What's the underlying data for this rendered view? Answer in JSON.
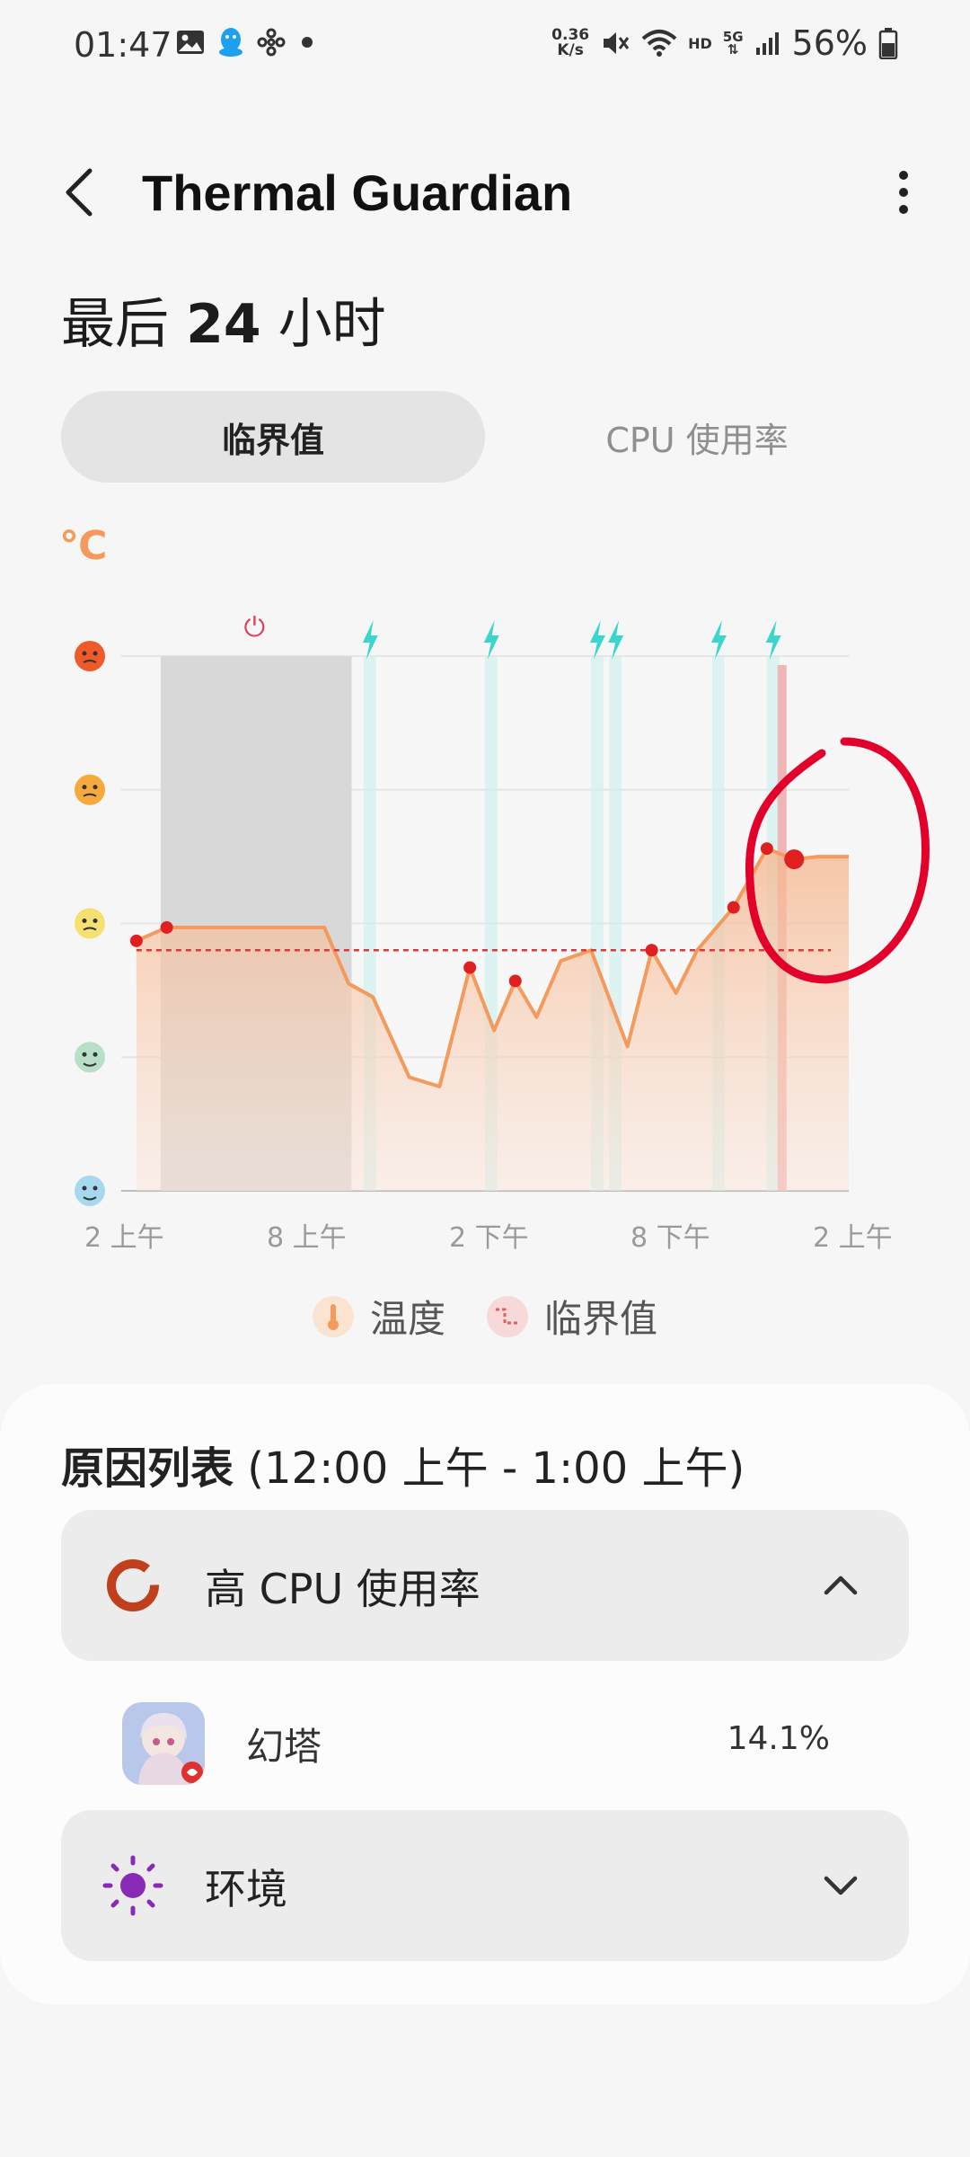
{
  "status_bar": {
    "time": "01:47",
    "net_speed_value": "0.36",
    "net_speed_unit": "K/s",
    "hd_label": "HD",
    "network_type": "5G",
    "battery": "56%"
  },
  "app_bar": {
    "title": "Thermal Guardian"
  },
  "range": {
    "prefix": "最后",
    "number": "24",
    "suffix": "小时"
  },
  "tabs": [
    {
      "label": "临界值",
      "selected": true
    },
    {
      "label": "CPU 使用率",
      "selected": false
    }
  ],
  "chart_data": {
    "type": "area",
    "y_unit": "℃",
    "y_levels": [
      "very-cold-face-icon",
      "cool-face-icon",
      "neutral-face-icon",
      "hot-face-icon",
      "very-hot-face-icon"
    ],
    "x_tick_labels": [
      "2 上午",
      "8 上午",
      "2 下午",
      "8 下午",
      "2 上午"
    ],
    "temperature_series": {
      "name": "温度",
      "x_hours": [
        0.5,
        1.5,
        3,
        5.5,
        6.7,
        7.5,
        8.3,
        9.5,
        10.5,
        11.5,
        12.3,
        13,
        13.7,
        14.5,
        15.5,
        16.7,
        17.5,
        18.3,
        19,
        20.2,
        21.3,
        22.2,
        23,
        24
      ],
      "y_level": [
        1.87,
        1.97,
        1.97,
        1.97,
        1.97,
        1.55,
        1.45,
        0.85,
        0.78,
        1.67,
        1.2,
        1.57,
        1.3,
        1.72,
        1.8,
        1.08,
        1.8,
        1.48,
        1.8,
        2.12,
        2.56,
        2.48,
        2.5,
        2.5
      ],
      "highlighted_points_hours": [
        0.5,
        1.5,
        11.5,
        13,
        17.5,
        20.2,
        21.3
      ]
    },
    "threshold": {
      "name": "临界值",
      "y_level": 1.8
    },
    "shaded_ranges_hours": [
      [
        1.3,
        7.6
      ]
    ],
    "charging_marker_hours": [
      8.2,
      12.2,
      15.7,
      16.3,
      19.7,
      21.5
    ],
    "power_marker_hours": [
      4.4
    ],
    "critical_marker_hours": [
      21.8
    ],
    "annotation": "red-circle-around-latest-point"
  },
  "legend": [
    {
      "label": "温度",
      "icon": "thermometer-icon",
      "color": "#f39a5c"
    },
    {
      "label": "临界值",
      "icon": "threshold-step-icon",
      "color": "#e06060"
    }
  ],
  "reasons": {
    "title_bold": "原因列表",
    "title_range": " (12:00 上午 - 1:00 上午)",
    "rows": [
      {
        "label": "高 CPU 使用率",
        "icon": "cpu-ring-icon",
        "expanded": true
      },
      {
        "label": "环境",
        "icon": "sun-icon",
        "expanded": false
      }
    ],
    "apps": [
      {
        "name": "幻塔",
        "percent": "14.1%",
        "icon": "tower-of-fantasy-app-icon"
      }
    ]
  },
  "colors": {
    "accent_orange": "#f39a5c",
    "threshold_red": "#d23c3c",
    "charging_cyan": "#38d6cc",
    "annotation_red": "#e3002a"
  }
}
